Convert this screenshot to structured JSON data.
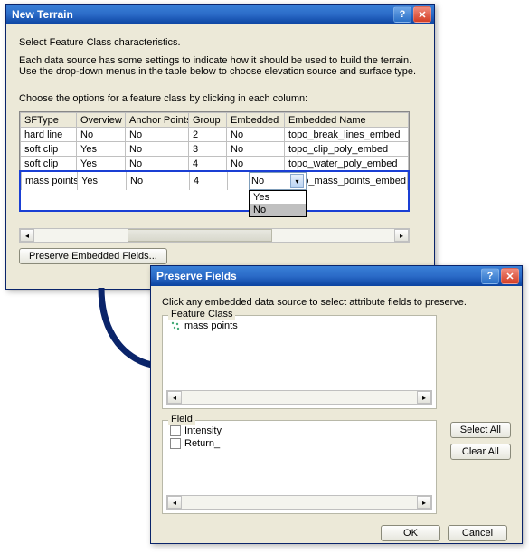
{
  "new_terrain": {
    "title": "New Terrain",
    "instr1": "Select Feature Class characteristics.",
    "instr2": "Each data source has some settings to indicate how it should be used to build the terrain.  Use the drop-down menus in the table below to choose elevation source and surface type.",
    "instr3": "Choose the options for a feature class by clicking in each column:",
    "columns": [
      "SFType",
      "Overview",
      "Anchor Points",
      "Group",
      "Embedded",
      "Embedded Name"
    ],
    "rows": [
      {
        "sftype": "hard line",
        "overview": "No",
        "anchor": "No",
        "group": "2",
        "embedded": "No",
        "ename": "topo_break_lines_embed"
      },
      {
        "sftype": "soft clip",
        "overview": "Yes",
        "anchor": "No",
        "group": "3",
        "embedded": "No",
        "ename": "topo_clip_poly_embed"
      },
      {
        "sftype": "soft clip",
        "overview": "Yes",
        "anchor": "No",
        "group": "4",
        "embedded": "No",
        "ename": "topo_water_poly_embed"
      }
    ],
    "active_row": {
      "sftype": "mass points",
      "overview": "Yes",
      "anchor": "No",
      "group": "4",
      "embedded": "No",
      "ename": "topo_mass_points_embed"
    },
    "dropdown": {
      "selected": "No",
      "options": [
        "Yes",
        "No"
      ]
    },
    "preserve_btn": "Preserve Embedded Fields..."
  },
  "preserve_fields": {
    "title": "Preserve Fields",
    "instr": "Click any embedded data source to select attribute fields to preserve.",
    "fc_label": "Feature Class",
    "fc_items": [
      "mass points"
    ],
    "field_label": "Field",
    "field_items": [
      "Intensity",
      "Return_"
    ],
    "select_all": "Select All",
    "clear_all": "Clear All",
    "ok": "OK",
    "cancel": "Cancel"
  }
}
